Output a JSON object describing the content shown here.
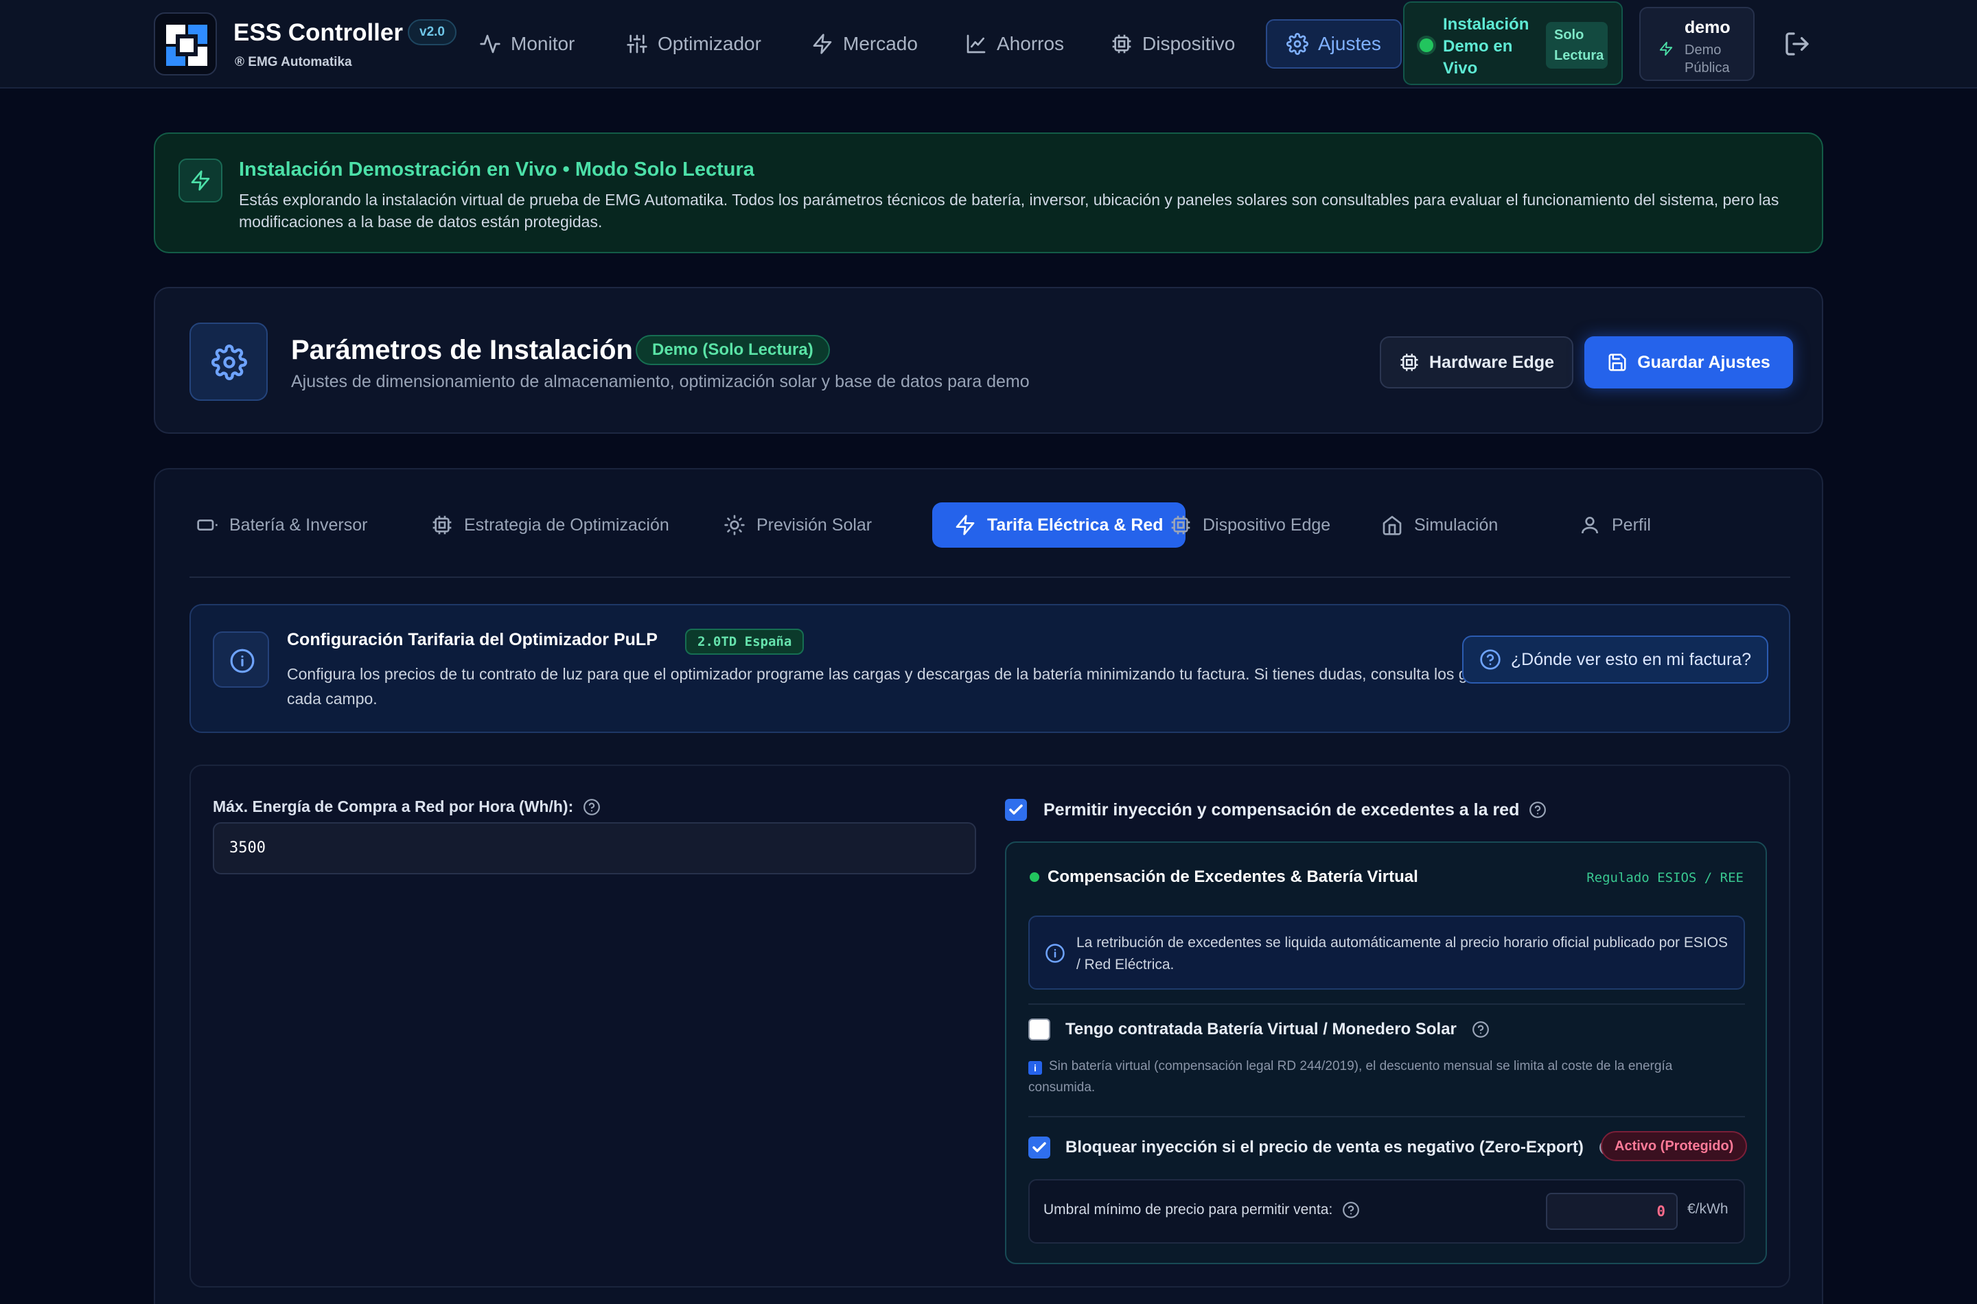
{
  "app": {
    "title": "ESS Controller",
    "version": "v2.0",
    "company": "® EMG Automatika"
  },
  "nav": {
    "items": [
      {
        "label": "Monitor",
        "icon": "activity-icon"
      },
      {
        "label": "Optimizador",
        "icon": "sliders-icon"
      },
      {
        "label": "Mercado",
        "icon": "zap-icon"
      },
      {
        "label": "Ahorros",
        "icon": "chart-line-icon"
      },
      {
        "label": "Dispositivo",
        "icon": "cpu-icon"
      },
      {
        "label": "Ajustes",
        "icon": "gear-icon",
        "active": true
      }
    ],
    "demo_status": "Instalación Demo en Vivo",
    "demo_mode": "Solo Lectura",
    "user_name": "demo",
    "user_role": "Demo Pública"
  },
  "banner": {
    "title": "Instalación Demostración en Vivo • Modo Solo Lectura",
    "description": "Estás explorando la instalación virtual de prueba de EMG Automatika. Todos los parámetros técnicos de batería, inversor, ubicación y paneles solares son consultables para evaluar el funcionamiento del sistema, pero las modificaciones a la base de datos están protegidas."
  },
  "header": {
    "title": "Parámetros de Instalación",
    "badge": "Demo (Solo Lectura)",
    "subtitle": "Ajustes de dimensionamiento de almacenamiento, optimización solar y base de datos para demo",
    "hardware_button": "Hardware Edge",
    "save_button": "Guardar Ajustes"
  },
  "tabs": [
    {
      "label": "Batería & Inversor",
      "icon": "battery-icon"
    },
    {
      "label": "Estrategia de Optimización",
      "icon": "cpu-icon"
    },
    {
      "label": "Previsión Solar",
      "icon": "sun-icon"
    },
    {
      "label": "Tarifa Eléctrica & Red",
      "icon": "zap-icon",
      "active": true
    },
    {
      "label": "Dispositivo Edge",
      "icon": "cpu-icon"
    },
    {
      "label": "Simulación",
      "icon": "home-icon"
    },
    {
      "label": "Perfil",
      "icon": "user-icon"
    }
  ],
  "info": {
    "title": "Configuración Tarifaria del Optimizador PuLP",
    "badge": "2.0TD España",
    "description_part1": "Configura los precios de tu contrato de luz para que el optimizador programe las cargas y descargas de la batería minimizando tu factura. Si tienes dudas, consulta los globos de ayuda",
    "description_part2": "en cada campo.",
    "invoice_button": "¿Dónde ver esto en mi factura?"
  },
  "form": {
    "max_purchase_label": "Máx. Energía de Compra a Red por Hora (Wh/h):",
    "max_purchase_value": "3500",
    "allow_injection_label": "Permitir inyección y compensación de excedentes a la red",
    "allow_injection_checked": true,
    "compensation": {
      "title": "Compensación de Excedentes & Batería Virtual",
      "tag": "Regulado ESIOS / REE",
      "esios_note": "La retribución de excedentes se liquida automáticamente al precio horario oficial publicado por ESIOS / Red Eléctrica.",
      "virtual_battery_label": "Tengo contratada Batería Virtual / Monedero Solar",
      "virtual_battery_checked": false,
      "virtual_battery_note_icon": "i",
      "virtual_battery_note": "Sin batería virtual (compensación legal RD 244/2019), el descuento mensual se limita al coste de la energía consumida.",
      "zero_export_label": "Bloquear inyección si el precio de venta es negativo (Zero-Export)",
      "zero_export_checked": true,
      "zero_export_badge": "Activo (Protegido)",
      "threshold_label": "Umbral mínimo de precio para permitir venta:",
      "threshold_value": "0",
      "threshold_unit": "€/kWh"
    }
  },
  "colors": {
    "background": "#050a1c",
    "accent": "#2563eb",
    "success": "#22c55e",
    "danger": "#ff7a98"
  }
}
